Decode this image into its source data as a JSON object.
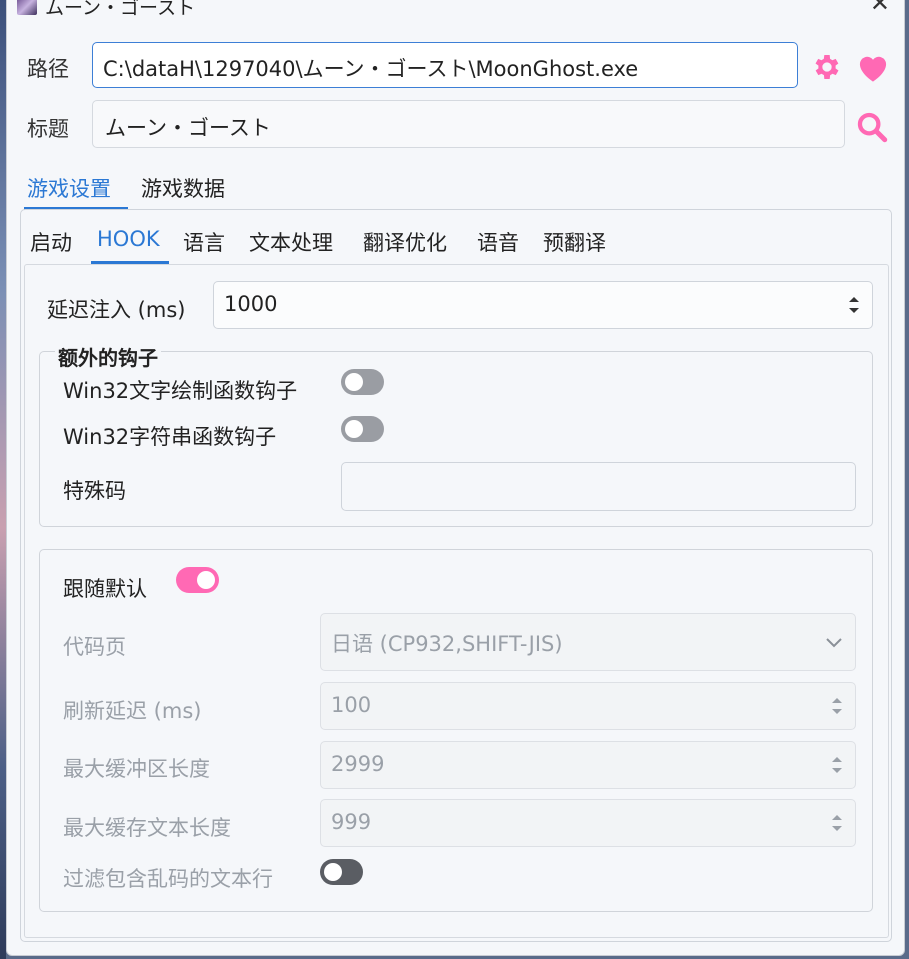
{
  "window": {
    "title": "ムーン・ゴースト",
    "close_glyph": "✕"
  },
  "path": {
    "label": "路径",
    "value": "C:\\dataH\\1297040\\ムーン・ゴースト\\MoonGhost.exe"
  },
  "title_row": {
    "label": "标题",
    "value": "ムーン・ゴースト"
  },
  "main_tabs": [
    {
      "label": "游戏设置",
      "active": true
    },
    {
      "label": "游戏数据",
      "active": false
    }
  ],
  "sub_tabs": [
    {
      "label": "启动",
      "active": false
    },
    {
      "label": "HOOK",
      "active": true
    },
    {
      "label": "语言",
      "active": false
    },
    {
      "label": "文本处理",
      "active": false
    },
    {
      "label": "翻译优化",
      "active": false
    },
    {
      "label": "语音",
      "active": false
    },
    {
      "label": "预翻译",
      "active": false
    }
  ],
  "hook": {
    "delay_label": "延迟注入 (ms)",
    "delay_value": "1000",
    "extra_hooks": {
      "title": "额外的钩子",
      "win32_text_label": "Win32文字绘制函数钩子",
      "win32_text_on": false,
      "win32_string_label": "Win32字符串函数钩子",
      "win32_string_on": false,
      "special_code_label": "特殊码",
      "special_code_value": ""
    },
    "defaults": {
      "follow_default_label": "跟随默认",
      "follow_default_on": true,
      "codepage_label": "代码页",
      "codepage_value": "日语 (CP932,SHIFT-JIS)",
      "refresh_delay_label": "刷新延迟 (ms)",
      "refresh_delay_value": "100",
      "max_buffer_label": "最大缓冲区长度",
      "max_buffer_value": "2999",
      "max_cache_label": "最大缓存文本长度",
      "max_cache_value": "999",
      "filter_garbled_label": "过滤包含乱码的文本行",
      "filter_garbled_on": false
    }
  },
  "colors": {
    "accent": "#2b78d4",
    "pink": "#ff69b4"
  },
  "icons": [
    "app-icon",
    "close-icon",
    "gear-icon",
    "heart-icon",
    "search-icon"
  ]
}
